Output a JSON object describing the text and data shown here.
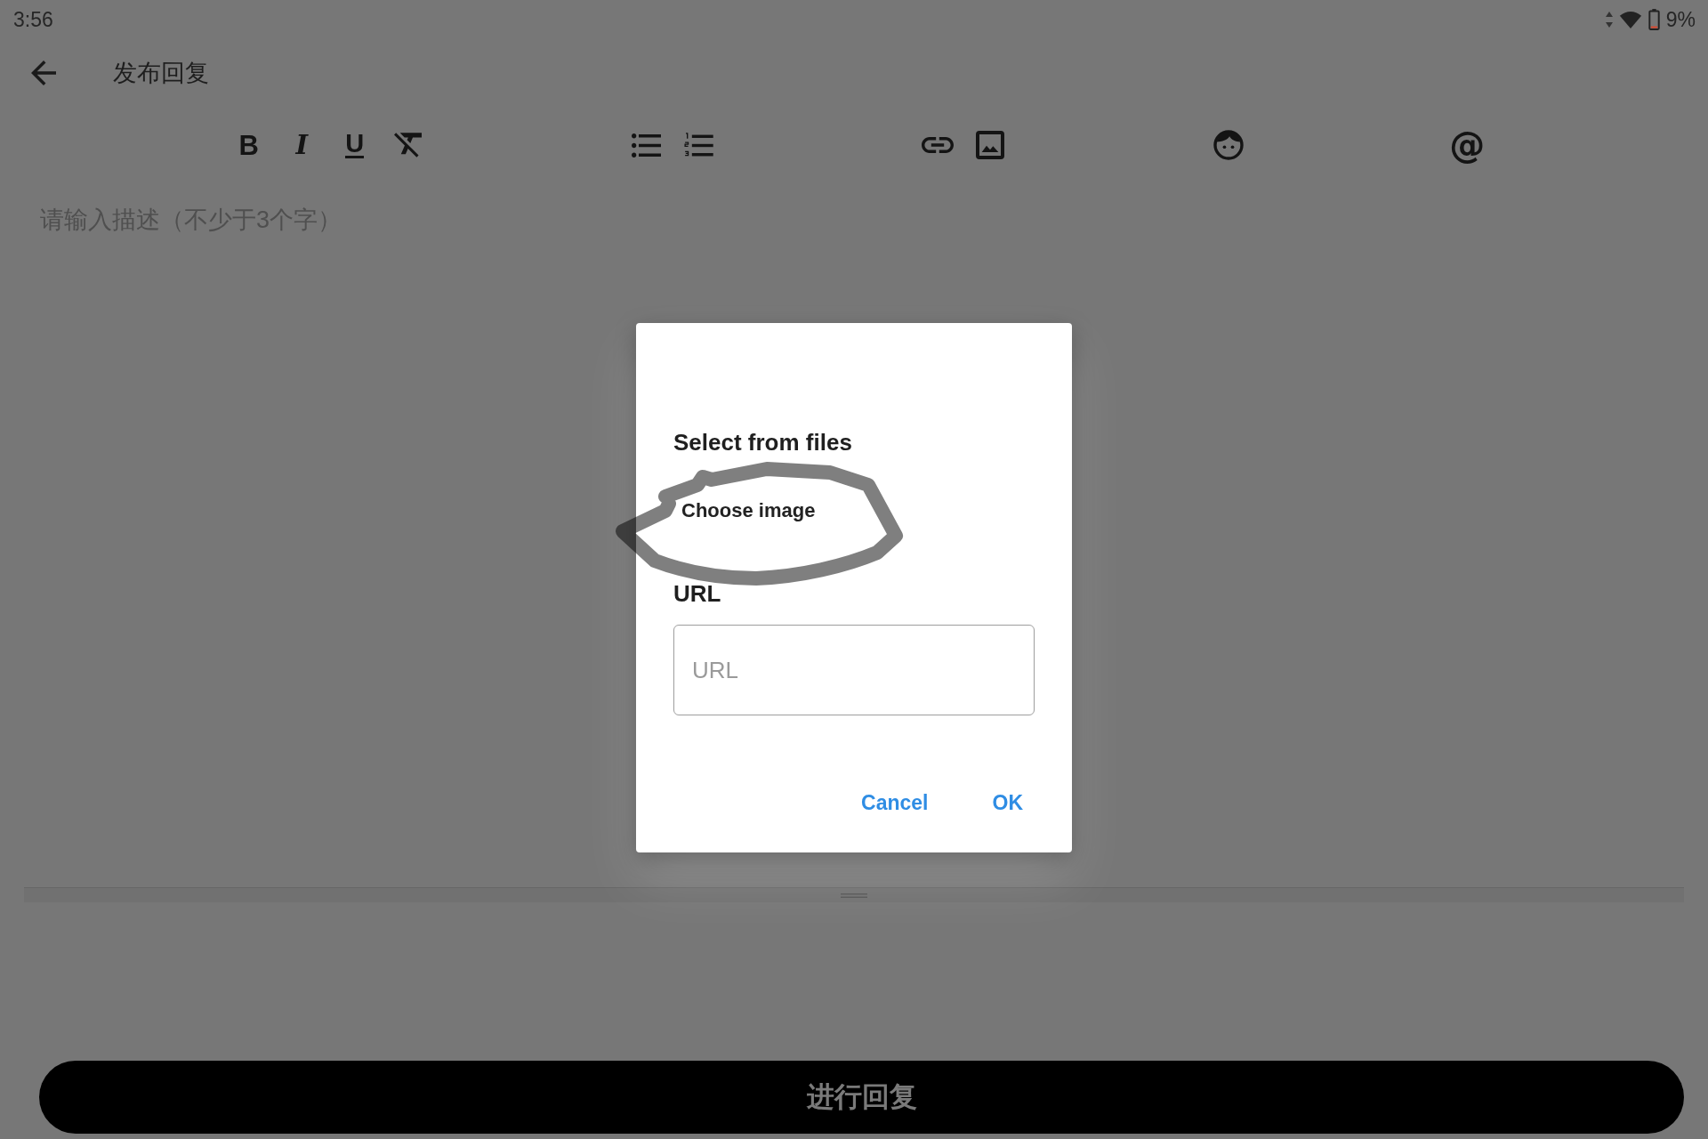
{
  "status_bar": {
    "time": "3:56",
    "battery": "9%"
  },
  "app_bar": {
    "title": "发布回复"
  },
  "toolbar": {
    "groups": [
      {
        "items": [
          {
            "kind": "bold",
            "glyph": "B"
          },
          {
            "kind": "italic",
            "glyph": "I"
          },
          {
            "kind": "underline",
            "glyph": "U"
          },
          {
            "kind": "clear_format"
          }
        ]
      },
      {
        "items": [
          {
            "kind": "bullet_list"
          },
          {
            "kind": "numbered_list"
          }
        ]
      },
      {
        "items": [
          {
            "kind": "link"
          },
          {
            "kind": "image"
          }
        ]
      },
      {
        "items": [
          {
            "kind": "emoji"
          }
        ]
      },
      {
        "items": [
          {
            "kind": "mention",
            "glyph": "@"
          }
        ]
      }
    ]
  },
  "editor": {
    "placeholder": "请输入描述（不少于3个字）"
  },
  "dialog": {
    "heading": "Select from files",
    "file_button": {
      "label": "Choose image",
      "circled": true
    },
    "url_label": "URL",
    "url_field": {
      "placeholder": "URL"
    },
    "buttons": [
      "Cancel",
      "OK"
    ]
  },
  "submit_button": {
    "label": "进行回复"
  }
}
